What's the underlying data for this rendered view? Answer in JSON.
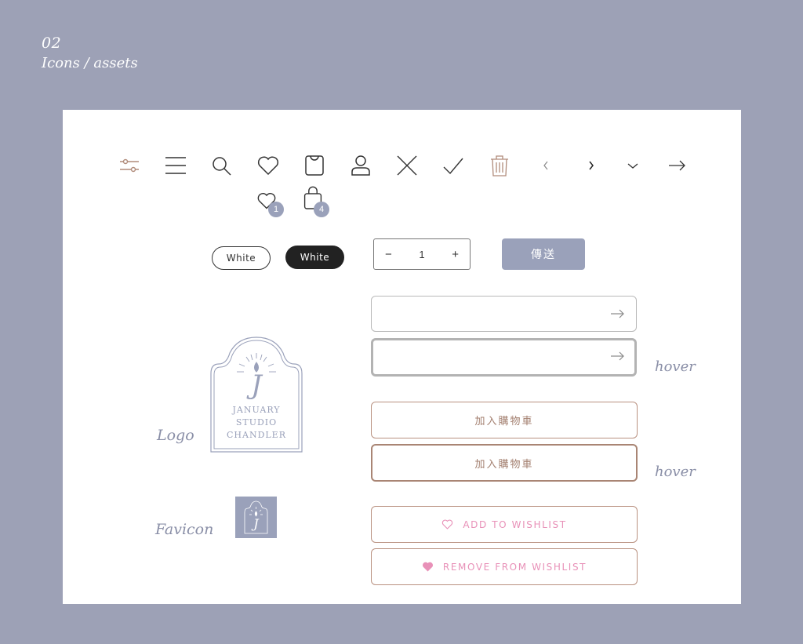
{
  "header": {
    "number": "02",
    "title": "Icons / assets"
  },
  "icons": [
    {
      "name": "filter-icon"
    },
    {
      "name": "menu-icon"
    },
    {
      "name": "search-icon"
    },
    {
      "name": "heart-icon"
    },
    {
      "name": "bag-icon"
    },
    {
      "name": "user-icon"
    },
    {
      "name": "close-icon"
    },
    {
      "name": "check-icon"
    },
    {
      "name": "trash-icon"
    },
    {
      "name": "chevron-left-icon"
    },
    {
      "name": "chevron-right-icon"
    },
    {
      "name": "chevron-down-icon"
    },
    {
      "name": "arrow-right-icon"
    }
  ],
  "badges": {
    "wishlist_count": "1",
    "cart_count": "4"
  },
  "variant_buttons": {
    "outline_label": "White",
    "filled_label": "White"
  },
  "quantity": {
    "minus": "−",
    "value": "1",
    "plus": "+"
  },
  "send_button": {
    "label": "傳送"
  },
  "cart_buttons": {
    "default_label": "加入購物車",
    "hover_label": "加入購物車"
  },
  "wishlist_buttons": {
    "add_label": "ADD TO WISHLIST",
    "remove_label": "REMOVE FROM WISHLIST"
  },
  "labels": {
    "hover": "hover",
    "logo": "Logo",
    "favicon": "Favicon"
  },
  "logo_text": {
    "line1": "JANUARY",
    "line2": "STUDIO",
    "line3": "CHANDLER"
  },
  "colors": {
    "background": "#9da1b6",
    "accent": "#9aa1ba",
    "brown": "#b99180",
    "pink": "#e891b8"
  }
}
